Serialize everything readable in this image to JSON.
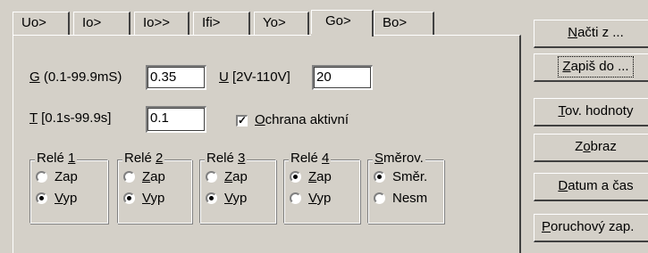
{
  "tabs": [
    "Uo>",
    "Io>",
    "Io>>",
    "Ifi>",
    "Yo>",
    "Go>",
    "Bo>"
  ],
  "active_tab": "Go>",
  "form": {
    "g_label_key": "G",
    "g_label_rest": " (0.1-99.9mS)",
    "g_value": "0.35",
    "u_label_key": "U",
    "u_label_rest": " [2V-110V]",
    "u_value": "20",
    "t_label_key": "T",
    "t_label_rest": " [0.1s-99.9s]",
    "t_value": "0.1",
    "checkbox_key": "O",
    "checkbox_rest": "chrana aktivní",
    "checkbox_checked": true
  },
  "groups": [
    {
      "title_pre": "Relé ",
      "title_key": "1",
      "title_post": "",
      "opt1_key": "",
      "opt1_rest": "Zap",
      "opt2_key": "V",
      "opt2_rest": "yp",
      "opt1_ul": false,
      "selected": 2
    },
    {
      "title_pre": "Relé ",
      "title_key": "2",
      "title_post": "",
      "opt1_key": "Z",
      "opt1_rest": "ap",
      "opt2_key": "V",
      "opt2_rest": "yp",
      "selected": 2
    },
    {
      "title_pre": "Relé ",
      "title_key": "3",
      "title_post": "",
      "opt1_key": "Z",
      "opt1_rest": "ap",
      "opt2_key": "V",
      "opt2_rest": "yp",
      "selected": 2
    },
    {
      "title_pre": "Relé ",
      "title_key": "4",
      "title_post": "",
      "opt1_key": "Z",
      "opt1_rest": "ap",
      "opt2_key": "V",
      "opt2_rest": "yp",
      "selected": 1
    },
    {
      "title_pre": "",
      "title_key": "S",
      "title_post": "měrov.",
      "opt1_key": "",
      "opt1_rest": "Směr.",
      "opt2_key": "",
      "opt2_rest": "Nesm",
      "selected": 1
    }
  ],
  "buttons": [
    {
      "key": "N",
      "rest": "ačti z ..."
    },
    {
      "key": "Z",
      "rest": "apiš do ..."
    },
    {
      "key": "T",
      "rest": "ov. hodnoty"
    },
    {
      "pre": "Z",
      "key": "o",
      "rest": "braz"
    },
    {
      "key": "D",
      "rest": "atum a čas"
    },
    {
      "key": "P",
      "rest": "oruchový zap."
    }
  ]
}
